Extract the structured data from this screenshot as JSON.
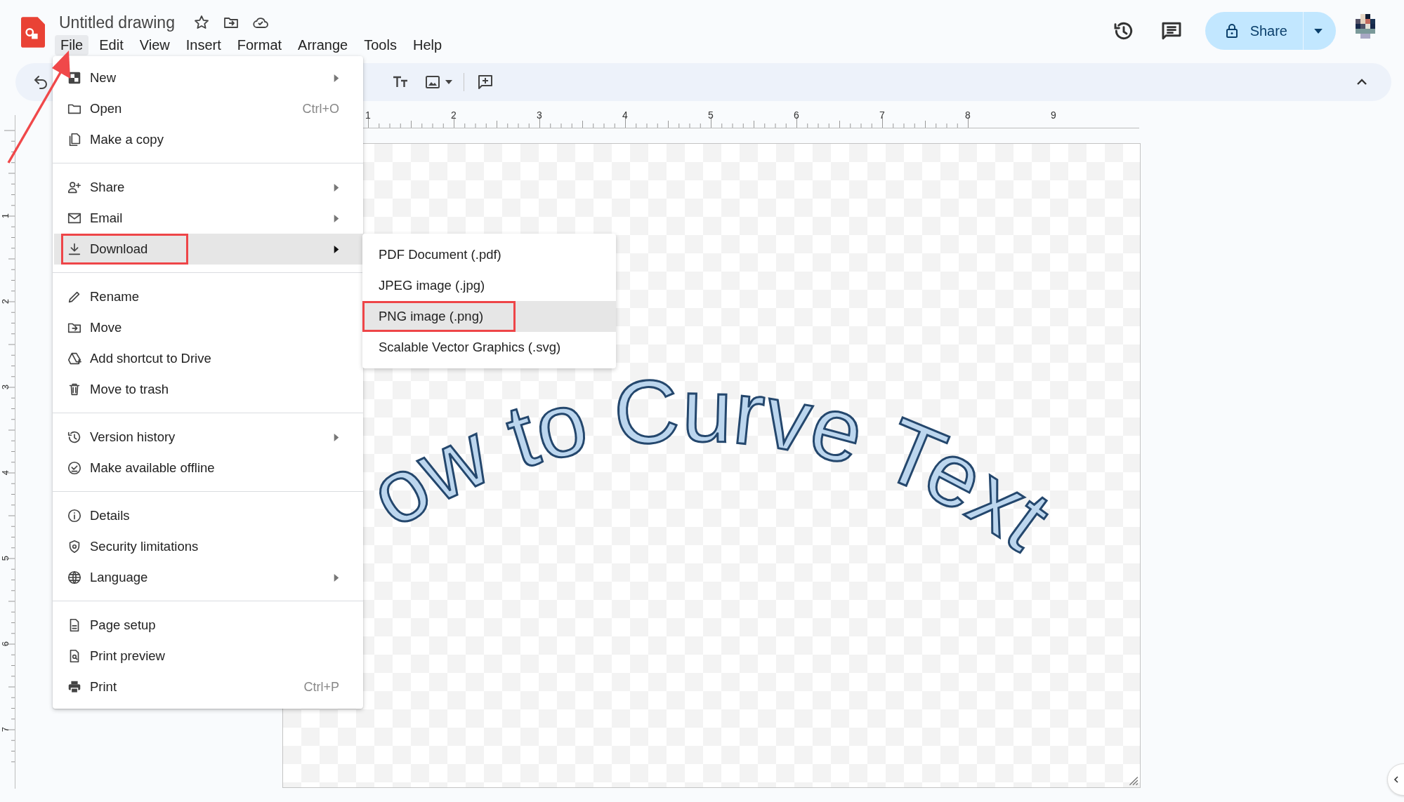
{
  "app": {
    "title": "Untitled drawing"
  },
  "menubar": [
    {
      "label": "File",
      "selected": true
    },
    {
      "label": "Edit",
      "selected": false
    },
    {
      "label": "View",
      "selected": false
    },
    {
      "label": "Insert",
      "selected": false
    },
    {
      "label": "Format",
      "selected": false
    },
    {
      "label": "Arrange",
      "selected": false
    },
    {
      "label": "Tools",
      "selected": false
    },
    {
      "label": "Help",
      "selected": false
    }
  ],
  "share_button": {
    "label": "Share"
  },
  "file_menu": {
    "sections": [
      [
        {
          "label": "New",
          "submenu": true,
          "selected": false
        },
        {
          "label": "Open",
          "shortcut": "Ctrl+O",
          "selected": false
        },
        {
          "label": "Make a copy",
          "selected": false
        }
      ],
      [
        {
          "label": "Share",
          "submenu": true,
          "selected": false
        },
        {
          "label": "Email",
          "submenu": true,
          "selected": false
        },
        {
          "label": "Download",
          "submenu": true,
          "selected": true
        }
      ],
      [
        {
          "label": "Rename",
          "selected": false
        },
        {
          "label": "Move",
          "selected": false
        },
        {
          "label": "Add shortcut to Drive",
          "selected": false
        },
        {
          "label": "Move to trash",
          "selected": false
        }
      ],
      [
        {
          "label": "Version history",
          "submenu": true,
          "selected": false
        },
        {
          "label": "Make available offline",
          "selected": false
        }
      ],
      [
        {
          "label": "Details",
          "selected": false
        },
        {
          "label": "Security limitations",
          "selected": false
        },
        {
          "label": "Language",
          "submenu": true,
          "selected": false
        }
      ],
      [
        {
          "label": "Page setup",
          "selected": false
        },
        {
          "label": "Print preview",
          "selected": false
        },
        {
          "label": "Print",
          "shortcut": "Ctrl+P",
          "selected": false
        }
      ]
    ]
  },
  "download_submenu": [
    {
      "label": "PDF Document (.pdf)",
      "selected": false
    },
    {
      "label": "JPEG image (.jpg)",
      "selected": false
    },
    {
      "label": "PNG image (.png)",
      "selected": true
    },
    {
      "label": "Scalable Vector Graphics (.svg)",
      "selected": false
    }
  ],
  "ruler": {
    "horizontal": [
      "1",
      "2",
      "3",
      "4",
      "5",
      "6",
      "7",
      "8",
      "9"
    ],
    "vertical": [
      "1",
      "2",
      "3",
      "4",
      "5",
      "6",
      "7"
    ]
  },
  "canvas": {
    "words": [
      "ow",
      "to",
      "Curve",
      "Text"
    ]
  }
}
